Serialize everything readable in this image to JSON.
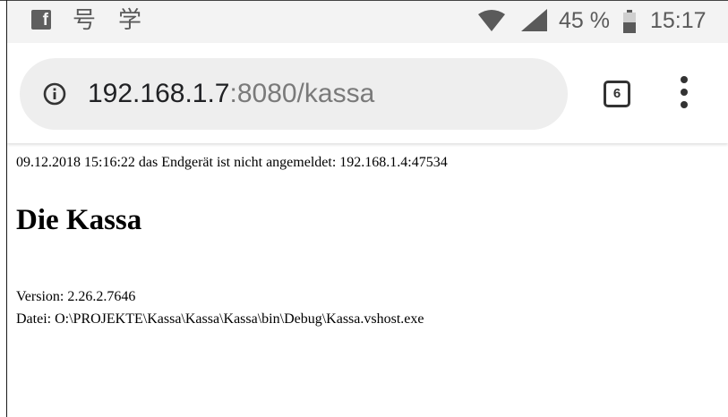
{
  "status_bar": {
    "app_icon_letter": "f",
    "notification_glyph_1": "号",
    "notification_glyph_2": "学",
    "battery_percent": "45 %",
    "time": "15:17",
    "icons": [
      "facebook-icon",
      "wifi-icon",
      "signal-icon",
      "battery-icon"
    ],
    "color": "#5a5a5a"
  },
  "browser": {
    "url_host": "192.168.1.7",
    "url_rest": ":8080/kassa",
    "tab_count": "6",
    "icons": [
      "info-icon",
      "tab-switcher-icon",
      "overflow-menu-icon"
    ],
    "pill_color": "#eeeeee"
  },
  "page": {
    "log_line": "09.12.2018 15:16:22 das Endgerät ist nicht angemeldet: 192.168.1.4:47534",
    "title": "Die Kassa",
    "version": "Version: 2.26.2.7646",
    "file": "Datei: O:\\PROJEKTE\\Kassa\\Kassa\\Kassa\\bin\\Debug\\Kassa.vshost.exe"
  }
}
